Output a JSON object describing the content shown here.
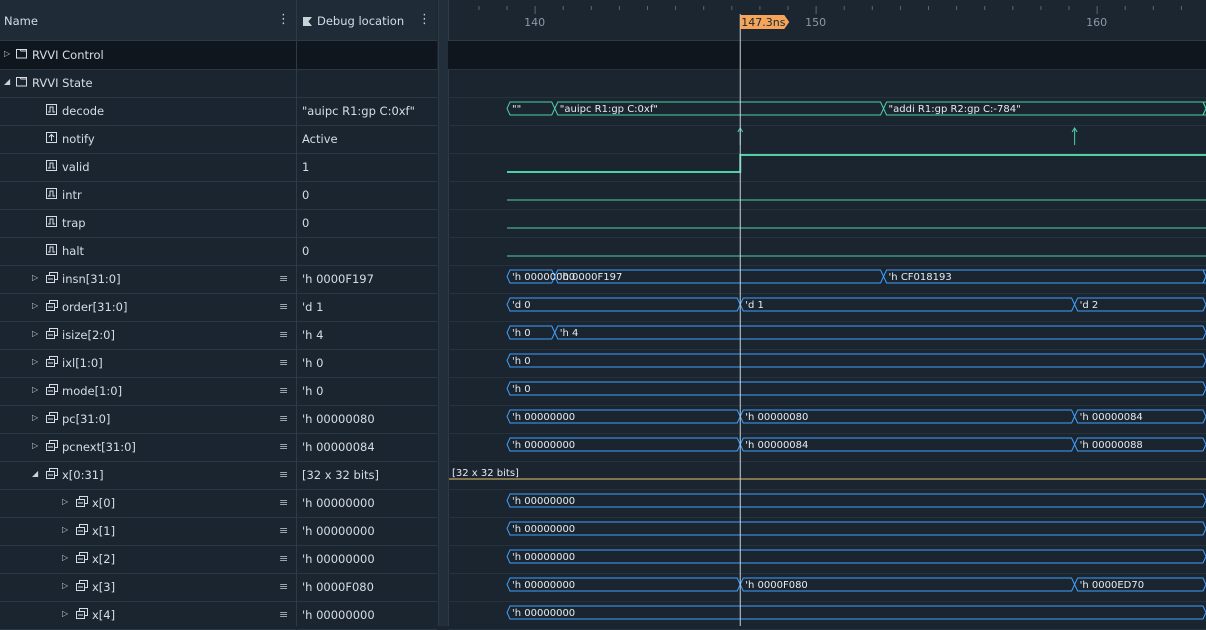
{
  "header": {
    "name_label": "Name",
    "debug_label": "Debug location",
    "ticks": [
      "140",
      "150",
      "160"
    ],
    "cursor_label": "147.3ns"
  },
  "rows": [
    {
      "name": "RVVI Control",
      "value": "",
      "kind": "group",
      "expand": "collapsed",
      "level": 0,
      "dark": true
    },
    {
      "name": "RVVI State",
      "value": "",
      "kind": "group",
      "expand": "expanded",
      "level": 0
    },
    {
      "name": "decode",
      "value": "\"auipc R1:gp C:0xf\"",
      "kind": "signal",
      "level": 1
    },
    {
      "name": "notify",
      "value": "Active",
      "kind": "event",
      "level": 1
    },
    {
      "name": "valid",
      "value": "1",
      "kind": "signal",
      "level": 1
    },
    {
      "name": "intr",
      "value": "0",
      "kind": "signal",
      "level": 1
    },
    {
      "name": "trap",
      "value": "0",
      "kind": "signal",
      "level": 1
    },
    {
      "name": "halt",
      "value": "0",
      "kind": "signal",
      "level": 1
    },
    {
      "name": "insn[31:0]",
      "value": "'h 0000F197",
      "kind": "bus",
      "expand": "collapsed",
      "level": 1
    },
    {
      "name": "order[31:0]",
      "value": "'d 1",
      "kind": "bus",
      "expand": "collapsed",
      "level": 1
    },
    {
      "name": "isize[2:0]",
      "value": "'h 4",
      "kind": "bus",
      "expand": "collapsed",
      "level": 1
    },
    {
      "name": "ixl[1:0]",
      "value": "'h 0",
      "kind": "bus",
      "expand": "collapsed",
      "level": 1
    },
    {
      "name": "mode[1:0]",
      "value": "'h 0",
      "kind": "bus",
      "expand": "collapsed",
      "level": 1
    },
    {
      "name": "pc[31:0]",
      "value": "'h 00000080",
      "kind": "bus",
      "expand": "collapsed",
      "level": 1
    },
    {
      "name": "pcnext[31:0]",
      "value": "'h 00000084",
      "kind": "bus",
      "expand": "collapsed",
      "level": 1
    },
    {
      "name": "x[0:31]",
      "value": "[32 x 32 bits]",
      "kind": "bus",
      "expand": "expanded",
      "level": 1
    },
    {
      "name": "x[0]",
      "value": "'h 00000000",
      "kind": "bus",
      "expand": "collapsed",
      "level": 2
    },
    {
      "name": "x[1]",
      "value": "'h 00000000",
      "kind": "bus",
      "expand": "collapsed",
      "level": 2
    },
    {
      "name": "x[2]",
      "value": "'h 00000000",
      "kind": "bus",
      "expand": "collapsed",
      "level": 2
    },
    {
      "name": "x[3]",
      "value": "'h 0000F080",
      "kind": "bus",
      "expand": "collapsed",
      "level": 2
    },
    {
      "name": "x[4]",
      "value": "'h 00000000",
      "kind": "bus",
      "expand": "collapsed",
      "level": 2
    }
  ],
  "waves": [
    {
      "type": "none"
    },
    {
      "type": "none"
    },
    {
      "type": "bus",
      "color": "#4fd1a5",
      "segments": [
        {
          "t0": 139.0,
          "t1": 140.7,
          "label": "\"\""
        },
        {
          "t0": 140.7,
          "t1": 152.4,
          "label": "\"auipc R1:gp C:0xf\""
        },
        {
          "t0": 152.4,
          "t1": 164.9,
          "label": "\"addi R1:gp R2:gp C:-784\""
        },
        {
          "t0": 164.9,
          "t1": 165.4,
          "label": "\""
        }
      ]
    },
    {
      "type": "event",
      "color": "#4fd1a5",
      "events": [
        147.3,
        159.2
      ]
    },
    {
      "type": "bit",
      "color": "#4fd1a5",
      "points": [
        [
          139.0,
          0
        ],
        [
          147.3,
          1
        ],
        [
          165.4,
          1
        ]
      ]
    },
    {
      "type": "bit",
      "color": "#4fd1a5",
      "points": [
        [
          139.0,
          0
        ],
        [
          165.4,
          0
        ]
      ]
    },
    {
      "type": "bit",
      "color": "#4fd1a5",
      "points": [
        [
          139.0,
          0
        ],
        [
          165.4,
          0
        ]
      ]
    },
    {
      "type": "bit",
      "color": "#4fd1a5",
      "points": [
        [
          139.0,
          0
        ],
        [
          165.4,
          0
        ]
      ]
    },
    {
      "type": "bus",
      "color": "#3fa0ff",
      "segments": [
        {
          "t0": 139.0,
          "t1": 140.7,
          "label": "'h 00000000"
        },
        {
          "t0": 140.7,
          "t1": 152.4,
          "label": "'h 0000F197"
        },
        {
          "t0": 152.4,
          "t1": 164.9,
          "label": "'h CF018193"
        },
        {
          "t0": 164.9,
          "t1": 165.4,
          "label": "'h"
        }
      ]
    },
    {
      "type": "bus",
      "color": "#3fa0ff",
      "segments": [
        {
          "t0": 139.0,
          "t1": 147.3,
          "label": "'d 0"
        },
        {
          "t0": 147.3,
          "t1": 159.2,
          "label": "'d 1"
        },
        {
          "t0": 159.2,
          "t1": 165.4,
          "label": "'d 2"
        }
      ]
    },
    {
      "type": "bus",
      "color": "#3fa0ff",
      "segments": [
        {
          "t0": 139.0,
          "t1": 140.7,
          "label": "'h 0"
        },
        {
          "t0": 140.7,
          "t1": 165.4,
          "label": "'h 4"
        }
      ]
    },
    {
      "type": "bus",
      "color": "#3fa0ff",
      "segments": [
        {
          "t0": 139.0,
          "t1": 165.4,
          "label": "'h 0"
        }
      ]
    },
    {
      "type": "bus",
      "color": "#3fa0ff",
      "segments": [
        {
          "t0": 139.0,
          "t1": 165.4,
          "label": "'h 0"
        }
      ]
    },
    {
      "type": "bus",
      "color": "#3fa0ff",
      "segments": [
        {
          "t0": 139.0,
          "t1": 147.3,
          "label": "'h 00000000"
        },
        {
          "t0": 147.3,
          "t1": 159.2,
          "label": "'h 00000080"
        },
        {
          "t0": 159.2,
          "t1": 165.4,
          "label": "'h 00000084"
        }
      ]
    },
    {
      "type": "bus",
      "color": "#3fa0ff",
      "segments": [
        {
          "t0": 139.0,
          "t1": 147.3,
          "label": "'h 00000000"
        },
        {
          "t0": 147.3,
          "t1": 159.2,
          "label": "'h 00000084"
        },
        {
          "t0": 159.2,
          "t1": 165.4,
          "label": "'h 00000088"
        }
      ]
    },
    {
      "type": "array",
      "color": "#e8c56b",
      "label": "[32 x 32 bits]"
    },
    {
      "type": "bus",
      "color": "#3fa0ff",
      "segments": [
        {
          "t0": 139.0,
          "t1": 165.4,
          "label": "'h 00000000"
        }
      ]
    },
    {
      "type": "bus",
      "color": "#3fa0ff",
      "segments": [
        {
          "t0": 139.0,
          "t1": 165.4,
          "label": "'h 00000000"
        }
      ]
    },
    {
      "type": "bus",
      "color": "#3fa0ff",
      "segments": [
        {
          "t0": 139.0,
          "t1": 165.4,
          "label": "'h 00000000"
        }
      ]
    },
    {
      "type": "bus",
      "color": "#3fa0ff",
      "segments": [
        {
          "t0": 139.0,
          "t1": 147.3,
          "label": "'h 00000000"
        },
        {
          "t0": 147.3,
          "t1": 159.2,
          "label": "'h 0000F080"
        },
        {
          "t0": 159.2,
          "t1": 165.4,
          "label": "'h 0000ED70"
        }
      ]
    },
    {
      "type": "bus",
      "color": "#3fa0ff",
      "segments": [
        {
          "t0": 139.0,
          "t1": 165.4,
          "label": "'h 00000000"
        }
      ]
    }
  ],
  "cursor_time": 147.3,
  "colors": {
    "cursor_marker": "#f5a55a",
    "cursor_line": "#c9d1d9"
  }
}
